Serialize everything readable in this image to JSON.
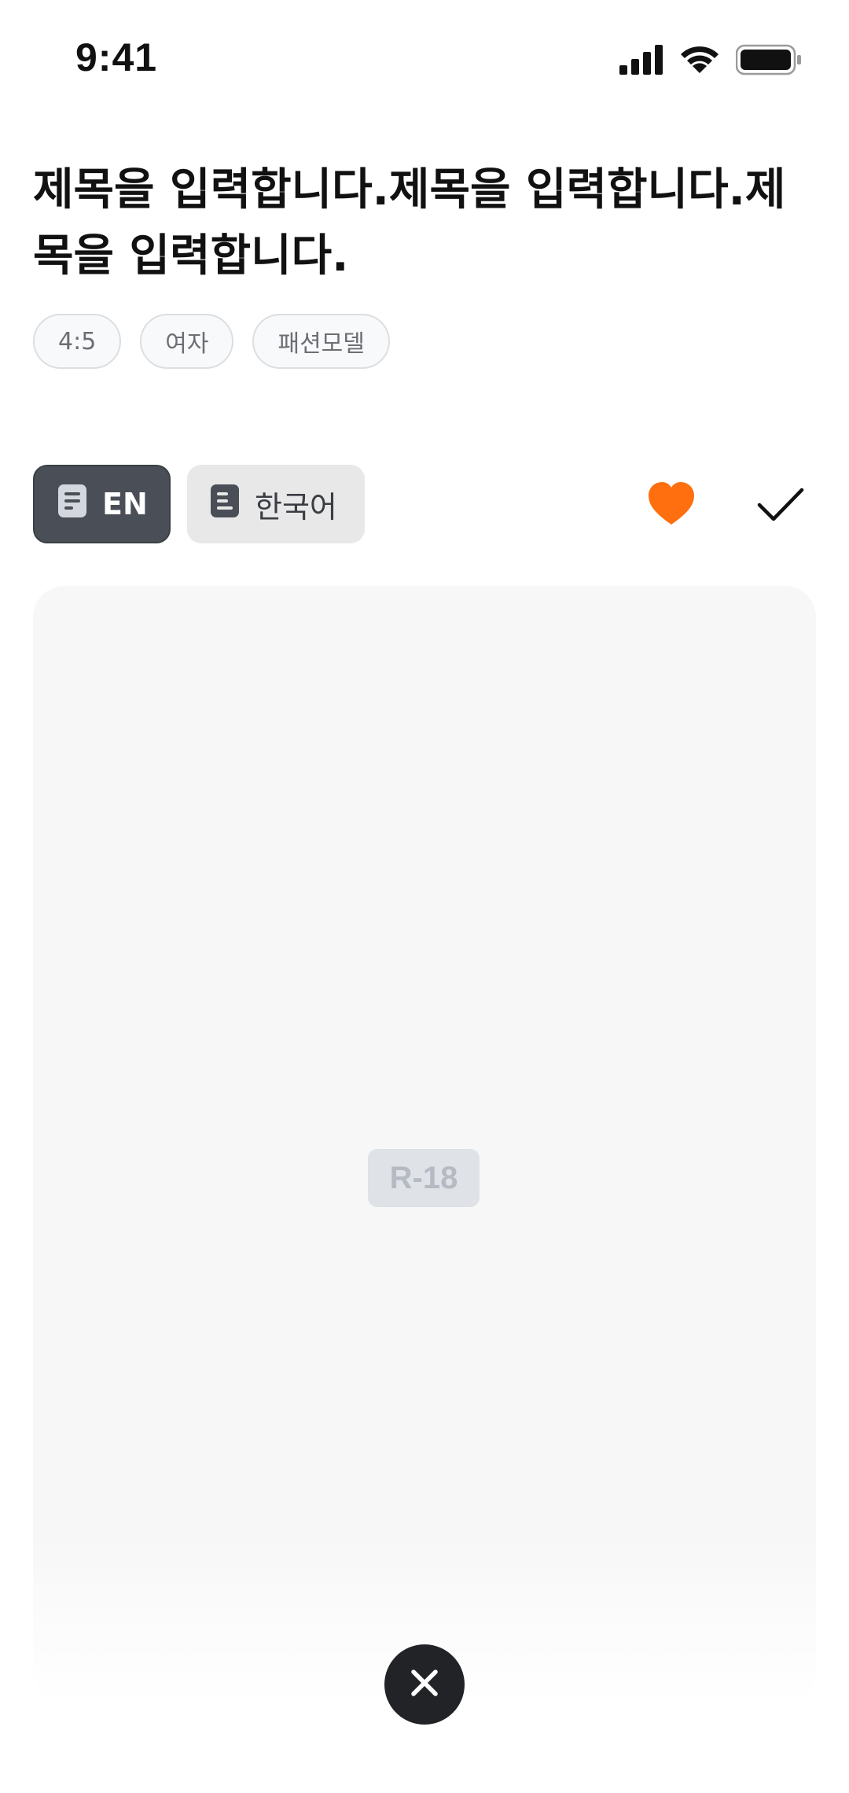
{
  "status_bar": {
    "time": "9:41",
    "icons": [
      "signal-icon",
      "wifi-icon",
      "battery-icon"
    ]
  },
  "title": "제목을 입력합니다.제목을 입력합니다.제목을 입력합니다.",
  "tags": [
    "4:5",
    "여자",
    "패션모델"
  ],
  "language_buttons": {
    "en_label": "EN",
    "ko_label": "한국어",
    "en_icon": "document-icon",
    "ko_icon": "document-icon",
    "selected": "EN"
  },
  "actions": {
    "favorite_icon": "heart-icon",
    "favorite_color": "#FF6F0F",
    "select_icon": "check-icon"
  },
  "card": {
    "rating": "R-18"
  },
  "close_button": {
    "icon": "close-icon"
  }
}
